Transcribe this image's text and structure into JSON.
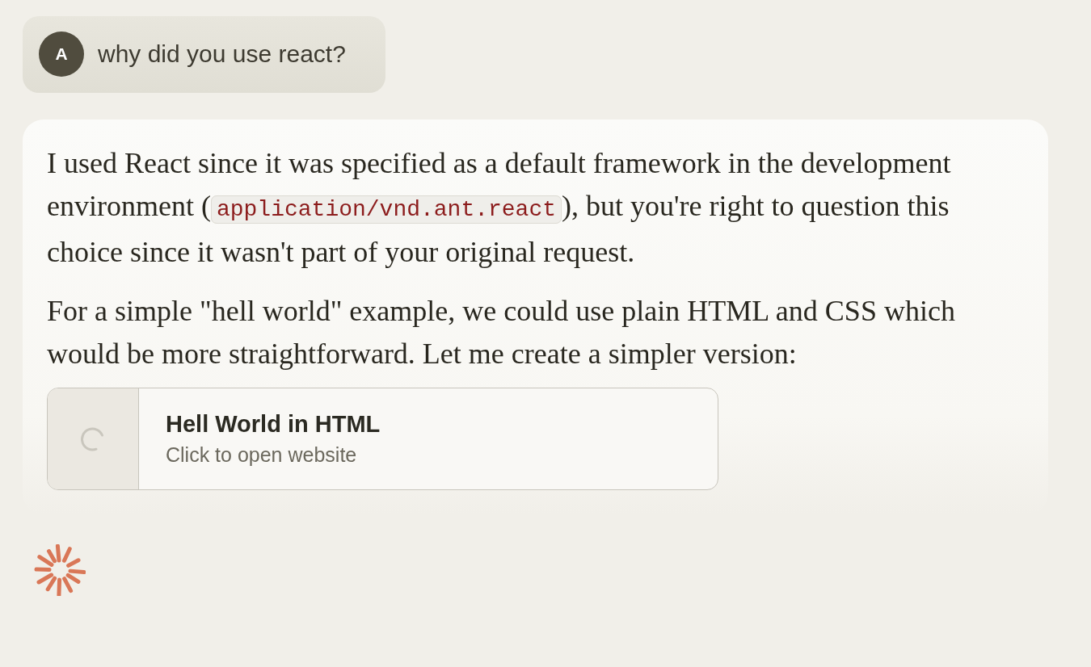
{
  "user_message": {
    "avatar": "A",
    "text": "why did you use react?"
  },
  "assistant_message": {
    "paragraphs": [
      [
        {
          "kind": "text",
          "text": "I used React since it was specified as a default framework in the development environment ("
        },
        {
          "kind": "code",
          "text": "application/vnd.ant.react"
        },
        {
          "kind": "text",
          "text": "), but you're right to question this choice since it wasn't part of your original request."
        }
      ],
      [
        {
          "kind": "text",
          "text": "For a simple \"hell world\" example, we could use plain HTML and CSS which would be more straightforward. Let me create a simpler version:"
        }
      ]
    ],
    "artifact": {
      "title": "Hell World in HTML",
      "subtitle": "Click to open website",
      "loading": true
    }
  },
  "status": {
    "responding": true
  }
}
